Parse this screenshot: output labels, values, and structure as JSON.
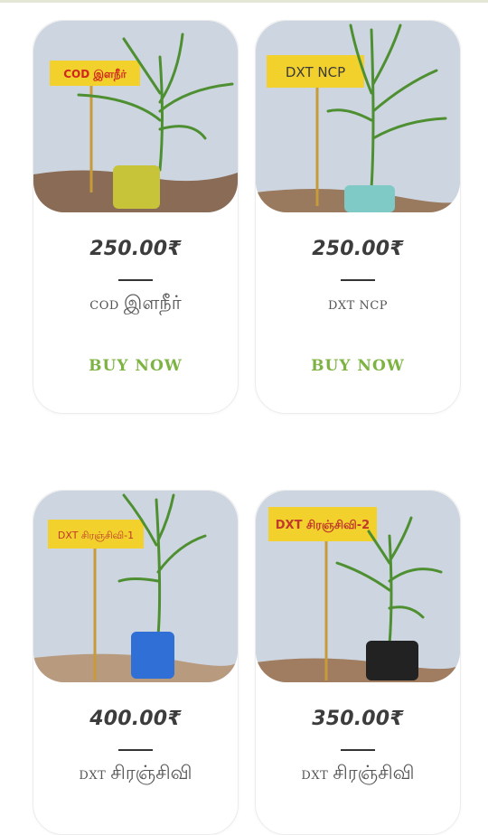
{
  "products": [
    {
      "price": "250.00₹",
      "name_latin": "COD",
      "name_tamil": "இளநீர்",
      "sign_text": "COD இளநீர்",
      "buy_label": "BUY NOW",
      "bag_color": "#c8c43a"
    },
    {
      "price": "250.00₹",
      "name_latin": "DXT NCP",
      "name_tamil": "",
      "sign_text": "DXT NCP",
      "buy_label": "BUY NOW",
      "bag_color": "#7fc9c6"
    },
    {
      "price": "400.00₹",
      "name_latin": "DXT",
      "name_tamil": "சிரஞ்சிவி",
      "sign_text": "DXT சிரஞ்சிவி-1",
      "bag_color": "#2f6fd6"
    },
    {
      "price": "350.00₹",
      "name_latin": "DXT",
      "name_tamil": "சிரஞ்சிவி",
      "sign_text": "DXT சிரஞ்சிவி-2",
      "bag_color": "#222222"
    }
  ],
  "colors": {
    "accent_green": "#7cb342",
    "price_text": "#3c3c3c",
    "sign_yellow": "#f2d12c"
  }
}
